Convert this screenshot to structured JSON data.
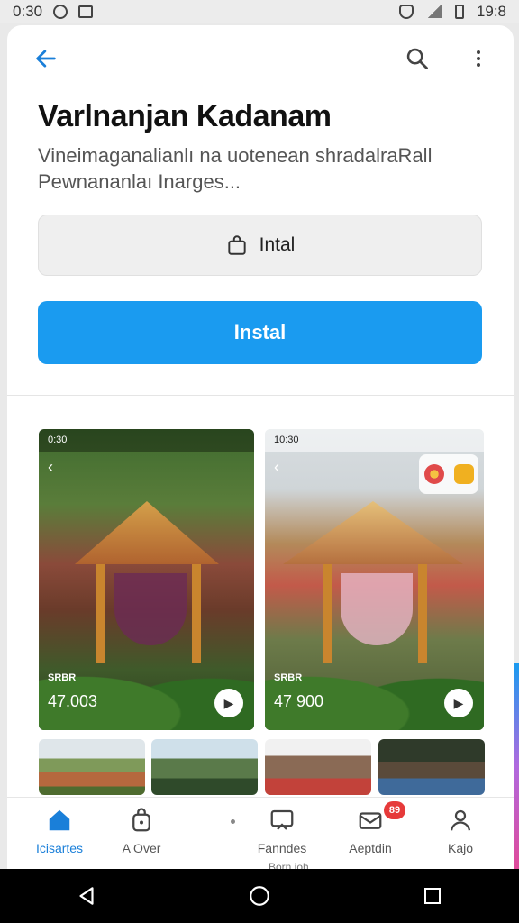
{
  "status_bar": {
    "time": "0:30",
    "battery_text": "19:8"
  },
  "app": {
    "title": "Varlnanjan Kadanam",
    "description": "Vineimaganalianlı na uotenean shradalraRall Pewnananlaı Inarges...",
    "secondary_button_label": "Intal",
    "primary_button_label": "Instal"
  },
  "screenshots": [
    {
      "status": "0:30",
      "tag": "SRBR",
      "count": "47.003"
    },
    {
      "status": "10:30",
      "tag": "SRBR",
      "count": "47 900"
    }
  ],
  "bottom_nav": {
    "items": [
      {
        "label": "Icisartes",
        "icon": "home-icon"
      },
      {
        "label": "A Over",
        "icon": "bag-icon"
      },
      {
        "label": "Fanndes",
        "icon": "cast-icon"
      },
      {
        "label": "Aeptdin",
        "icon": "mail-icon",
        "badge": "89"
      },
      {
        "label": "Kajo",
        "icon": "person-icon"
      }
    ],
    "sub_label": "Born ioh"
  },
  "colors": {
    "accent": "#1a9bf0",
    "active_nav": "#1a7fd9",
    "badge": "#e63a3a"
  }
}
